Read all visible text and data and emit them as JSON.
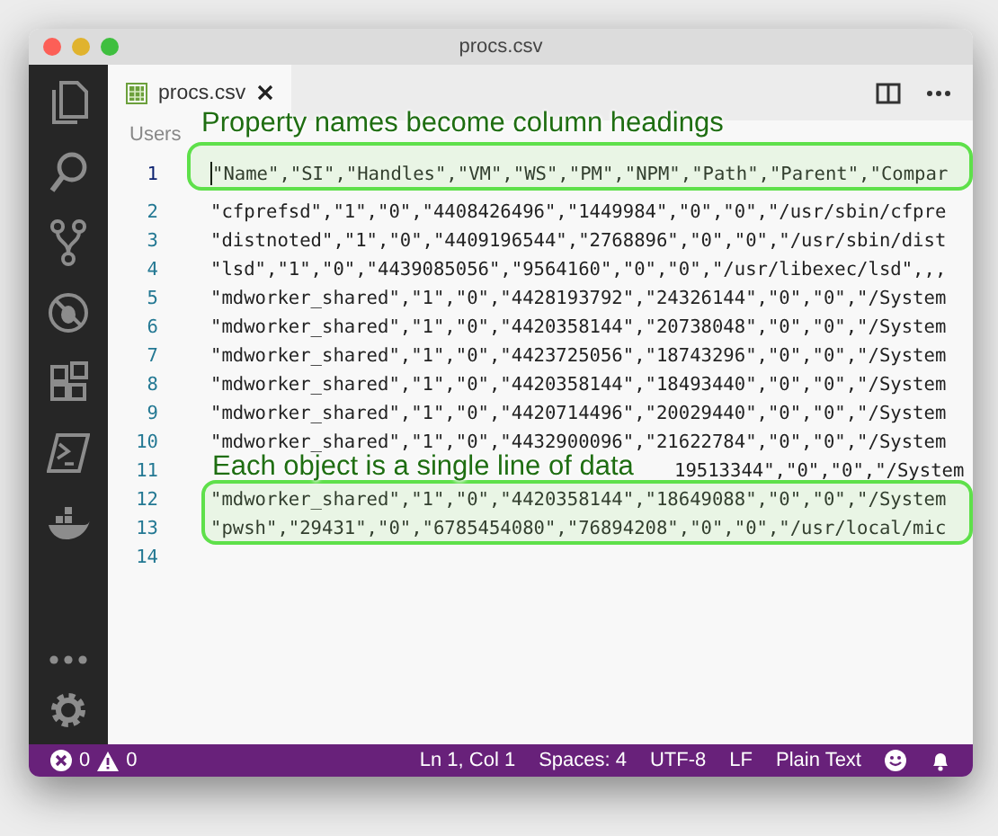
{
  "window": {
    "title": "procs.csv"
  },
  "tabs": [
    {
      "label": "procs.csv",
      "selected": true
    }
  ],
  "breadcrumb": "Users",
  "editor": {
    "lines": [
      {
        "number": "1",
        "text": "\"Name\",\"SI\",\"Handles\",\"VM\",\"WS\",\"PM\",\"NPM\",\"Path\",\"Parent\",\"Compar",
        "kind": "code",
        "cursor": true
      },
      {
        "number": "2",
        "text": "\"cfprefsd\",\"1\",\"0\",\"4408426496\",\"1449984\",\"0\",\"0\",\"/usr/sbin/cfpre",
        "kind": "code",
        "cursor": false
      },
      {
        "number": "3",
        "text": "\"distnoted\",\"1\",\"0\",\"4409196544\",\"2768896\",\"0\",\"0\",\"/usr/sbin/dist",
        "kind": "code",
        "cursor": false
      },
      {
        "number": "4",
        "text": "\"lsd\",\"1\",\"0\",\"4439085056\",\"9564160\",\"0\",\"0\",\"/usr/libexec/lsd\",,,",
        "kind": "code",
        "cursor": false
      },
      {
        "number": "5",
        "text": "\"mdworker_shared\",\"1\",\"0\",\"4428193792\",\"24326144\",\"0\",\"0\",\"/System",
        "kind": "code",
        "cursor": false
      },
      {
        "number": "6",
        "text": "\"mdworker_shared\",\"1\",\"0\",\"4420358144\",\"20738048\",\"0\",\"0\",\"/System",
        "kind": "code",
        "cursor": false
      },
      {
        "number": "7",
        "text": "\"mdworker_shared\",\"1\",\"0\",\"4423725056\",\"18743296\",\"0\",\"0\",\"/System",
        "kind": "code",
        "cursor": false
      },
      {
        "number": "8",
        "text": "\"mdworker_shared\",\"1\",\"0\",\"4420358144\",\"18493440\",\"0\",\"0\",\"/System",
        "kind": "code",
        "cursor": false
      },
      {
        "number": "9",
        "text": "\"mdworker_shared\",\"1\",\"0\",\"4420714496\",\"20029440\",\"0\",\"0\",\"/System",
        "kind": "code",
        "cursor": false
      },
      {
        "number": "10",
        "text": "\"mdworker_shared\",\"1\",\"0\",\"4432900096\",\"21622784\",\"0\",\"0\",\"/System",
        "kind": "code",
        "cursor": false
      },
      {
        "number": "11",
        "text": "19513344\",\"0\",\"0\",\"/System",
        "kind": "covered",
        "cursor": false
      },
      {
        "number": "12",
        "text": "\"mdworker_shared\",\"1\",\"0\",\"4420358144\",\"18649088\",\"0\",\"0\",\"/System",
        "kind": "code",
        "cursor": false
      },
      {
        "number": "13",
        "text": "\"pwsh\",\"29431\",\"0\",\"6785454080\",\"76894208\",\"0\",\"0\",\"/usr/local/mic",
        "kind": "code",
        "cursor": false
      },
      {
        "number": "14",
        "kind": "code",
        "cursor": false
      }
    ]
  },
  "annotations": [
    {
      "text": "Property names become column headings",
      "kind": "header"
    },
    {
      "text": "Each object is a single line of data",
      "kind": "rows"
    }
  ],
  "status_bar": {
    "errors": "0",
    "warnings": "0",
    "items": [
      "Ln 1, Col 1",
      "Spaces: 4",
      "UTF-8",
      "LF",
      "Plain Text"
    ]
  }
}
